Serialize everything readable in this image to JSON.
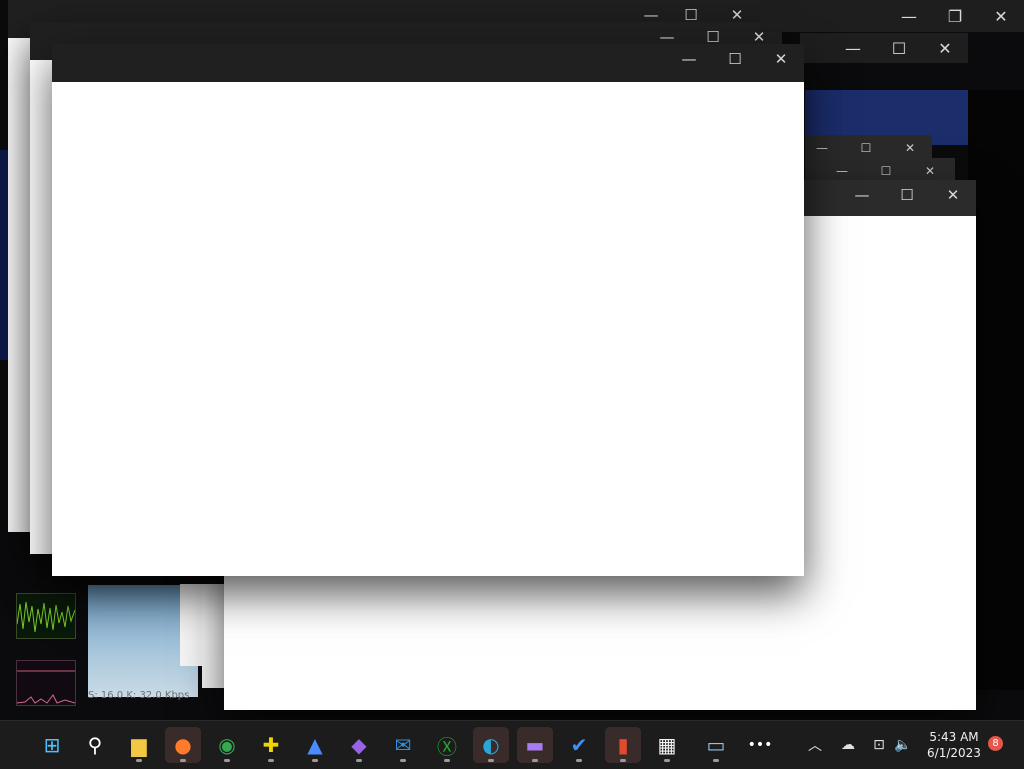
{
  "window_controls": {
    "minimize": "—",
    "maximize": "☐",
    "close": "✕",
    "restore": "❐"
  },
  "desktop": {
    "status_text": "S: 16.0 K: 32.0 Kbps"
  },
  "taskbar": {
    "items": [
      {
        "name": "start-button",
        "glyph": "⊞",
        "color": "#4cc2ff"
      },
      {
        "name": "search-button",
        "glyph": "⚲",
        "color": "#ffffff"
      },
      {
        "name": "file-explorer",
        "glyph": "▆",
        "color": "#f2c744"
      },
      {
        "name": "firefox",
        "glyph": "●",
        "color": "#ff7b2b"
      },
      {
        "name": "chrome",
        "glyph": "◉",
        "color": "#36a852"
      },
      {
        "name": "app-plus",
        "glyph": "✚",
        "color": "#f0d400"
      },
      {
        "name": "app-blue",
        "glyph": "▲",
        "color": "#4a8cff"
      },
      {
        "name": "visual-studio",
        "glyph": "◆",
        "color": "#9a63e6"
      },
      {
        "name": "mail",
        "glyph": "✉",
        "color": "#2f8ee0"
      },
      {
        "name": "xbox",
        "glyph": "Ⓧ",
        "color": "#23a32b"
      },
      {
        "name": "edge",
        "glyph": "◐",
        "color": "#28a7d9"
      },
      {
        "name": "clipchamp",
        "glyph": "▬",
        "color": "#a87cf0"
      },
      {
        "name": "todo",
        "glyph": "✔",
        "color": "#3e8ef7"
      },
      {
        "name": "office",
        "glyph": "▮",
        "color": "#e04b2c"
      },
      {
        "name": "store",
        "glyph": "▦",
        "color": "#f2f2f2"
      },
      {
        "name": "resource-monitor",
        "glyph": "▭",
        "color": "#8fc0e6"
      },
      {
        "name": "more-button",
        "glyph": "•••",
        "color": "#ffffff"
      }
    ],
    "tray": {
      "chevron": "︿",
      "onedrive": "☁",
      "network": "⊡",
      "volume": "🔈"
    },
    "time": "5:43 AM",
    "date": "6/1/2023",
    "notification_count": "8"
  }
}
